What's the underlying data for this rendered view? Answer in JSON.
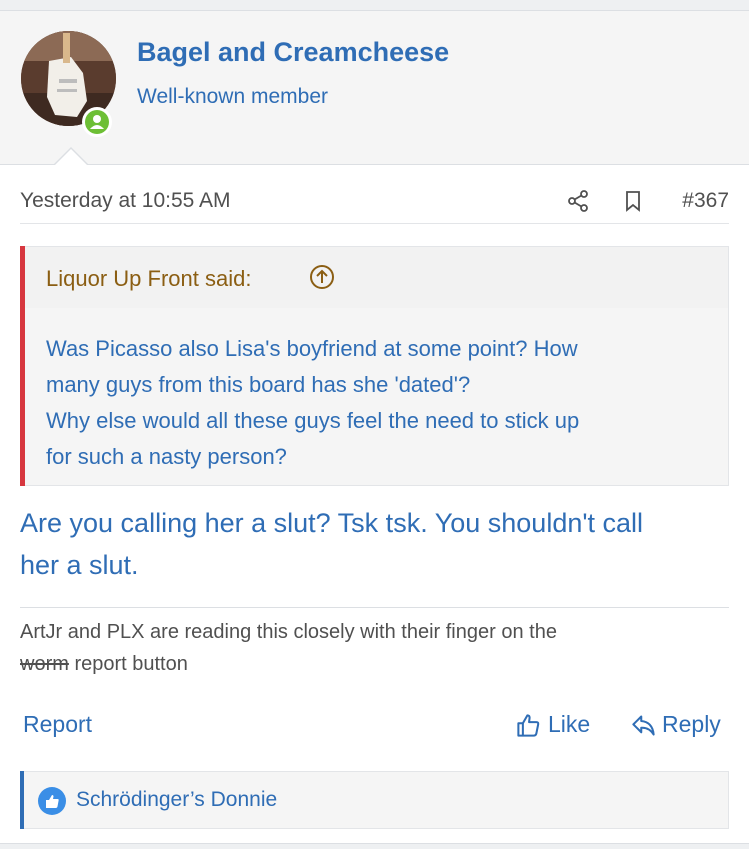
{
  "author": {
    "name": "Bagel and Creamcheese",
    "title": "Well-known member"
  },
  "post": {
    "timestamp": "Yesterday at 10:55 AM",
    "number": "#367",
    "quote": {
      "author": "Liquor Up Front said:",
      "lines": [
        "Was Picasso also Lisa's boyfriend at some point? How",
        "many guys from this board has she 'dated'?",
        "Why else would all these guys feel the need to stick up",
        "for such a nasty person?"
      ]
    },
    "message_lines": [
      "Are you calling her a slut? Tsk tsk. You shouldn't call",
      "her a slut."
    ],
    "signature": {
      "line1": "ArtJr and PLX are reading this closely with their finger on the",
      "struck_word": "worm",
      "line2_rest": " report button"
    }
  },
  "actions": {
    "report": "Report",
    "like": "Like",
    "reply": "Reply"
  },
  "reactions": {
    "names": "Schrödinger’s Donnie"
  },
  "icons": {
    "online": "user-online-icon",
    "share": "share-icon",
    "bookmark": "bookmark-icon",
    "quote_jump": "arrow-up-circle-icon",
    "like": "thumbs-up-icon",
    "reply": "reply-arrow-icon",
    "reaction": "like-reaction-icon"
  },
  "colors": {
    "link": "#2f6db5",
    "quote_bar": "#d7373f",
    "quote_author": "#8b5e13",
    "online": "#6dbf35",
    "reaction": "#3a8ee6"
  }
}
